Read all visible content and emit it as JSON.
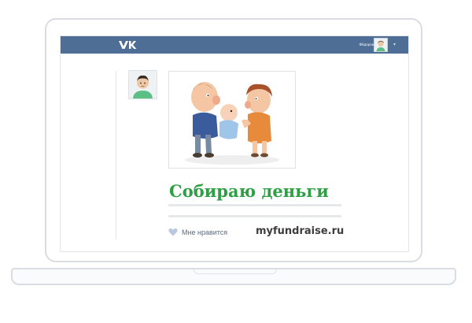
{
  "topbar": {
    "logo": "VK",
    "user_name": "Фёдоров",
    "menu_caret": "▾"
  },
  "post": {
    "image_alt": "Двое взрослых персонажей с младенцем",
    "title": "Собираю деньги",
    "like_label": "Мне нравится",
    "site": "myfundraise.ru"
  },
  "colors": {
    "topbar": "#4e6e96",
    "title": "#2f9e45",
    "like_text": "#5a6b80"
  },
  "icons": {
    "logo": "vk-logo-icon",
    "like": "heart-icon",
    "avatar": "user-avatar-icon"
  }
}
